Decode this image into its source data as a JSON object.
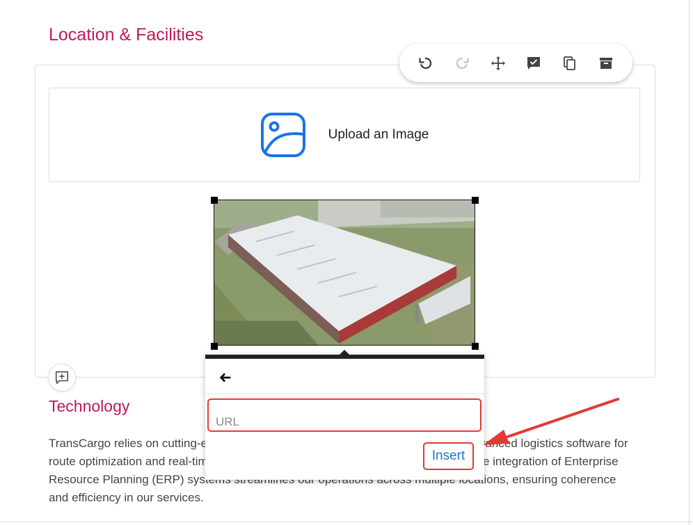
{
  "sections": {
    "location_title": "Location & Facilities",
    "tech_title": "Technology",
    "tech_text": "TransCargo relies on cutting-edge technology to enhance our services. We use advanced logistics software for route optimization and real-time tracking of shipments for efficient management. The integration of Enterprise Resource Planning (ERP) systems streamlines our operations across multiple locations, ensuring coherence and efficiency in our services."
  },
  "toolbar": {
    "icons": [
      "undo-icon",
      "redo-icon",
      "move-icon",
      "comment-check-icon",
      "copy-icon",
      "archive-icon"
    ]
  },
  "upload": {
    "label": "Upload an Image",
    "icon": "image-icon"
  },
  "image_popup": {
    "url_placeholder": "URL",
    "url_value": "",
    "insert_label": "Insert"
  },
  "colors": {
    "title": "#c2185b",
    "accent_blue": "#1a73e8",
    "highlight_red": "#e53935",
    "link_blue": "#1976d2"
  }
}
